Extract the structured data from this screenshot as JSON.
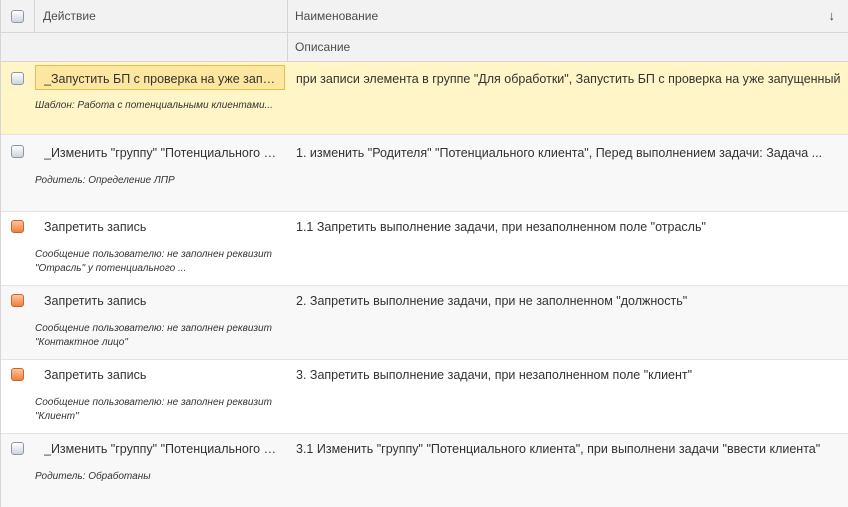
{
  "header": {
    "action_col": "Действие",
    "name_col": "Наименование",
    "description_col": "Описание",
    "sort_indicator": "↓"
  },
  "rows": [
    {
      "checkbox": "gray",
      "action": "_Запустить БП с проверка на уже запущенный",
      "detail": "Шаблон: Работа с потенциальными клиентами...",
      "description": "при записи элемента в группе \"Для обработки\", Запустить БП с проверка на уже запущенный",
      "selected": true
    },
    {
      "checkbox": "gray",
      "action": "_Изменить \"группу\" \"Потенциального клиента\"",
      "detail": "Родитель: Определение ЛПР",
      "description": "1. изменить \"Родителя\" \"Потенциального клиента\", Перед выполнением задачи: Задача ..."
    },
    {
      "checkbox": "orange",
      "action": "Запретить запись",
      "detail": "Сообщение пользователю: не заполнен реквизит \"Отрасль\" у потенциального ...",
      "description": "1.1 Запретить выполнение задачи, при незаполненном поле \"отрасль\""
    },
    {
      "checkbox": "orange",
      "action": "Запретить запись",
      "detail": "Сообщение пользователю: не заполнен реквизит \"Контактное лицо\"",
      "description": "2. Запретить выполнение задачи, при не заполненном \"должность\""
    },
    {
      "checkbox": "orange",
      "action": "Запретить запись",
      "detail": "Сообщение пользователю: не заполнен реквизит \"Клиент\"",
      "description": "3. Запретить выполнение задачи, при незаполненном поле \"клиент\""
    },
    {
      "checkbox": "gray",
      "action": "_Изменить \"группу\" \"Потенциального клиента\"",
      "detail": "Родитель: Обработаны",
      "description": "3.1 Изменить \"группу\" \"Потенциального клиента\", при выполнени задачи \"ввести клиента\""
    }
  ],
  "colors": {
    "selected_row": "#fff5c6",
    "selected_cell": "#fde7a0",
    "header_bg": "#f2f2f2",
    "checkbox_orange": "#f0803f"
  }
}
